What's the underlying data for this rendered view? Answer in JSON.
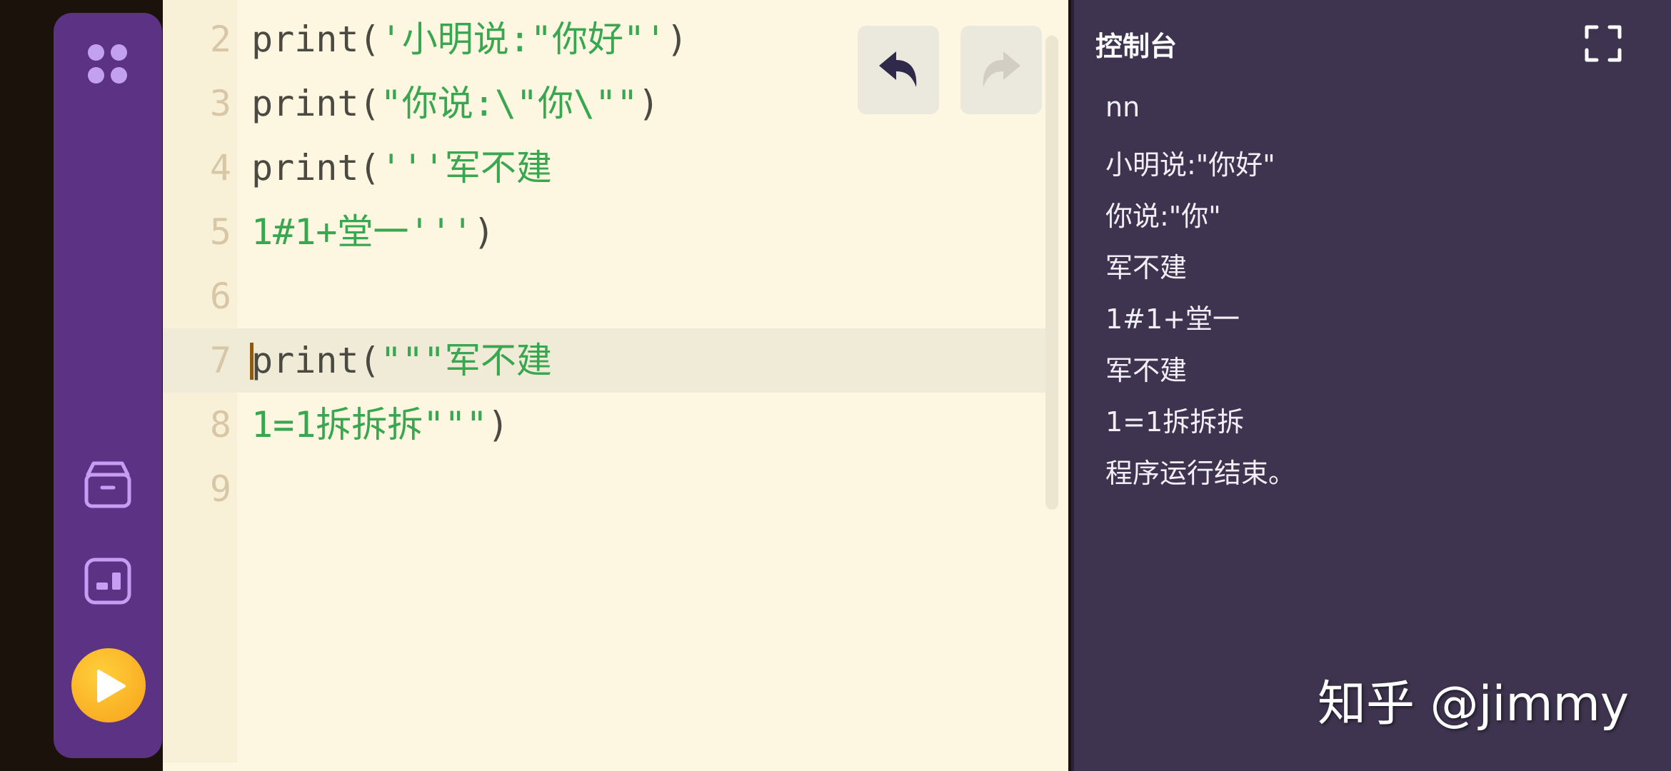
{
  "editor": {
    "lines": [
      {
        "num": "2",
        "tokens": [
          {
            "t": "print(",
            "s": false
          },
          {
            "t": "'小明说:\"你好\"'",
            "s": true
          },
          {
            "t": ")",
            "s": false
          }
        ]
      },
      {
        "num": "3",
        "tokens": [
          {
            "t": "print(",
            "s": false
          },
          {
            "t": "\"你说:\\\"你\\\"\"",
            "s": true
          },
          {
            "t": ")",
            "s": false
          }
        ]
      },
      {
        "num": "4",
        "tokens": [
          {
            "t": "print(",
            "s": false
          },
          {
            "t": "'''军不建",
            "s": true
          }
        ]
      },
      {
        "num": "5",
        "tokens": [
          {
            "t": "1#1+堂一'''",
            "s": true
          },
          {
            "t": ")",
            "s": false
          }
        ]
      },
      {
        "num": "6",
        "tokens": []
      },
      {
        "num": "7",
        "active": true,
        "tokens": [
          {
            "t": "print(",
            "s": false
          },
          {
            "t": "\"\"\"军不建",
            "s": true
          }
        ]
      },
      {
        "num": "8",
        "tokens": [
          {
            "t": "1=1拆拆拆\"\"\"",
            "s": true
          },
          {
            "t": ")",
            "s": false
          }
        ]
      },
      {
        "num": "9",
        "tokens": []
      }
    ]
  },
  "console": {
    "title": "控制台",
    "output": [
      "nn",
      "小明说:\"你好\"",
      "你说:\"你\"",
      "军不建",
      "1#1+堂一",
      "军不建",
      "1=1拆拆拆",
      "程序运行结束。"
    ]
  },
  "watermark": "知乎 @jimmy",
  "colors": {
    "sidebar": "#5c3285",
    "editor_bg": "#fdf6e0",
    "string": "#39a650",
    "console_bg": "#3e344f",
    "run_button": "#f7a11a"
  },
  "icons": [
    "apps-grid-icon",
    "archive-box-icon",
    "panel-layout-icon",
    "play-icon",
    "undo-icon",
    "redo-icon",
    "chevron-right-icon",
    "fullscreen-icon"
  ]
}
